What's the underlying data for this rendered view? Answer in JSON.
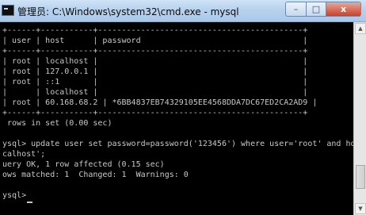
{
  "window": {
    "title": "管理员: C:\\Windows\\system32\\cmd.exe - mysql",
    "icon": "cmd-icon",
    "buttons": {
      "minimize": "–",
      "maximize": "□",
      "close": "x"
    }
  },
  "console": {
    "lines": [
      "+------+-----------+-------------------------------------------+",
      "| user | host      | password                                  |",
      "+------+-----------+-------------------------------------------+",
      "| root | localhost |                                           |",
      "| root | 127.0.0.1 |                                           |",
      "| root | ::1       |                                           |",
      "|      | localhost |                                           |",
      "| root | 60.168.68.2 | *6BB4837EB74329105EE4568DDA7DC67ED2CA2AD9 |",
      "+------+-----------+-------------------------------------------+",
      " rows in set (0.00 sec)",
      "",
      "ysql> update user set password=password('123456') where user='root' and host='l",
      "calhost';",
      "uery OK, 1 row affected (0.15 sec)",
      "ows matched: 1  Changed: 1  Warnings: 0",
      "",
      "ysql>"
    ]
  },
  "scrollbar": {
    "up": "▲",
    "down": "▼"
  }
}
